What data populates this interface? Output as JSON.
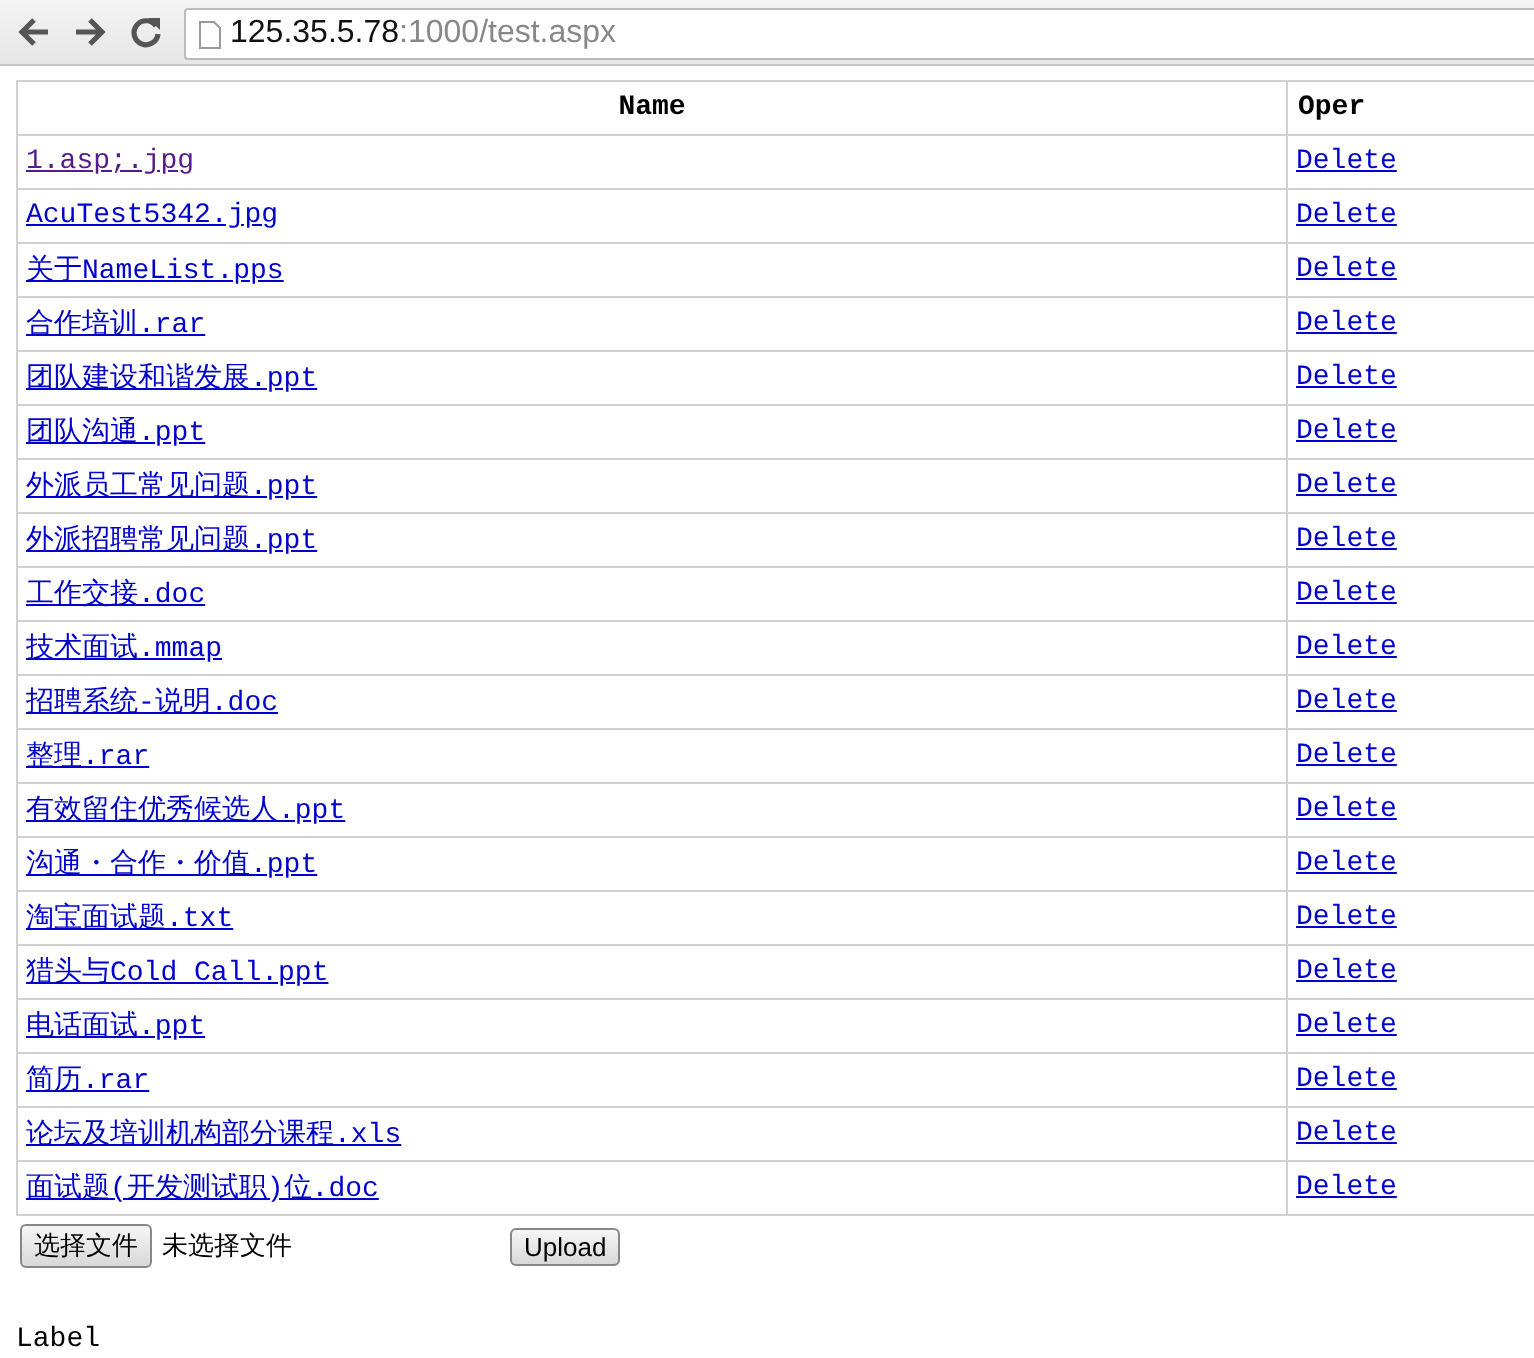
{
  "browser": {
    "address_host": "125.35.5.78",
    "address_path": ":1000/test.aspx"
  },
  "table": {
    "columns": [
      "Name",
      "Oper"
    ],
    "rows": [
      {
        "name": "1.asp;.jpg",
        "visited": true,
        "action": "Delete"
      },
      {
        "name": "AcuTest5342.jpg",
        "visited": false,
        "action": "Delete"
      },
      {
        "name": "关于NameList.pps",
        "visited": false,
        "action": "Delete"
      },
      {
        "name": "合作培训.rar",
        "visited": false,
        "action": "Delete"
      },
      {
        "name": "团队建设和谐发展.ppt",
        "visited": false,
        "action": "Delete"
      },
      {
        "name": "团队沟通.ppt",
        "visited": false,
        "action": "Delete"
      },
      {
        "name": "外派员工常见问题.ppt",
        "visited": false,
        "action": "Delete"
      },
      {
        "name": "外派招聘常见问题.ppt",
        "visited": false,
        "action": "Delete"
      },
      {
        "name": "工作交接.doc",
        "visited": false,
        "action": "Delete"
      },
      {
        "name": "技术面试.mmap",
        "visited": false,
        "action": "Delete"
      },
      {
        "name": "招聘系统-说明.doc",
        "visited": false,
        "action": "Delete"
      },
      {
        "name": "整理.rar",
        "visited": false,
        "action": "Delete"
      },
      {
        "name": "有效留住优秀候选人.ppt",
        "visited": false,
        "action": "Delete"
      },
      {
        "name": "沟通・合作・价值.ppt",
        "visited": false,
        "action": "Delete"
      },
      {
        "name": "淘宝面试题.txt",
        "visited": false,
        "action": "Delete"
      },
      {
        "name": "猎头与Cold Call.ppt",
        "visited": false,
        "action": "Delete"
      },
      {
        "name": "电话面试.ppt",
        "visited": false,
        "action": "Delete"
      },
      {
        "name": "简历.rar",
        "visited": false,
        "action": "Delete"
      },
      {
        "name": "论坛及培训机构部分课程.xls",
        "visited": false,
        "action": "Delete"
      },
      {
        "name": "面试题(开发测试职)位.doc",
        "visited": false,
        "action": "Delete"
      }
    ]
  },
  "upload": {
    "choose_button": "选择文件",
    "file_status": "未选择文件",
    "upload_button": "Upload"
  },
  "label": "Label"
}
